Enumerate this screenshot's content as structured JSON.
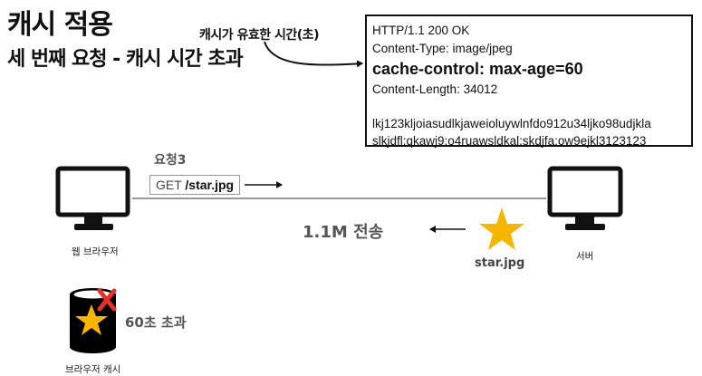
{
  "title": "캐시 적용",
  "subtitle": "세 번째 요청 - 캐시 시간 초과",
  "ttl_note": "캐시가 유효한 시간(초)",
  "http_response": {
    "status_line": "HTTP/1.1 200 OK",
    "content_type": "Content-Type: image/jpeg",
    "cache_control": "cache-control: max-age=60",
    "content_length": "Content-Length: 34012",
    "body_line1": "lkj123kljoiasudlkjaweioluywlnfdo912u34ljko98udjkla",
    "body_line2": "slkjdfl;qkawj9;o4ruawsldkal;skdjfa;ow9ejkl3123123"
  },
  "request": {
    "label": "요청3",
    "method": "GET",
    "path": "/star.jpg"
  },
  "transfer_label": "1.1M 전송",
  "client_label": "웹 브라우저",
  "server_label": "서버",
  "resource_label": "star.jpg",
  "cache_label": "브라우저 캐시",
  "expired_label": "60초 초과",
  "colors": {
    "star": "#f7b500",
    "expired_mark": "#e8302a",
    "cylinder": "#000000"
  }
}
